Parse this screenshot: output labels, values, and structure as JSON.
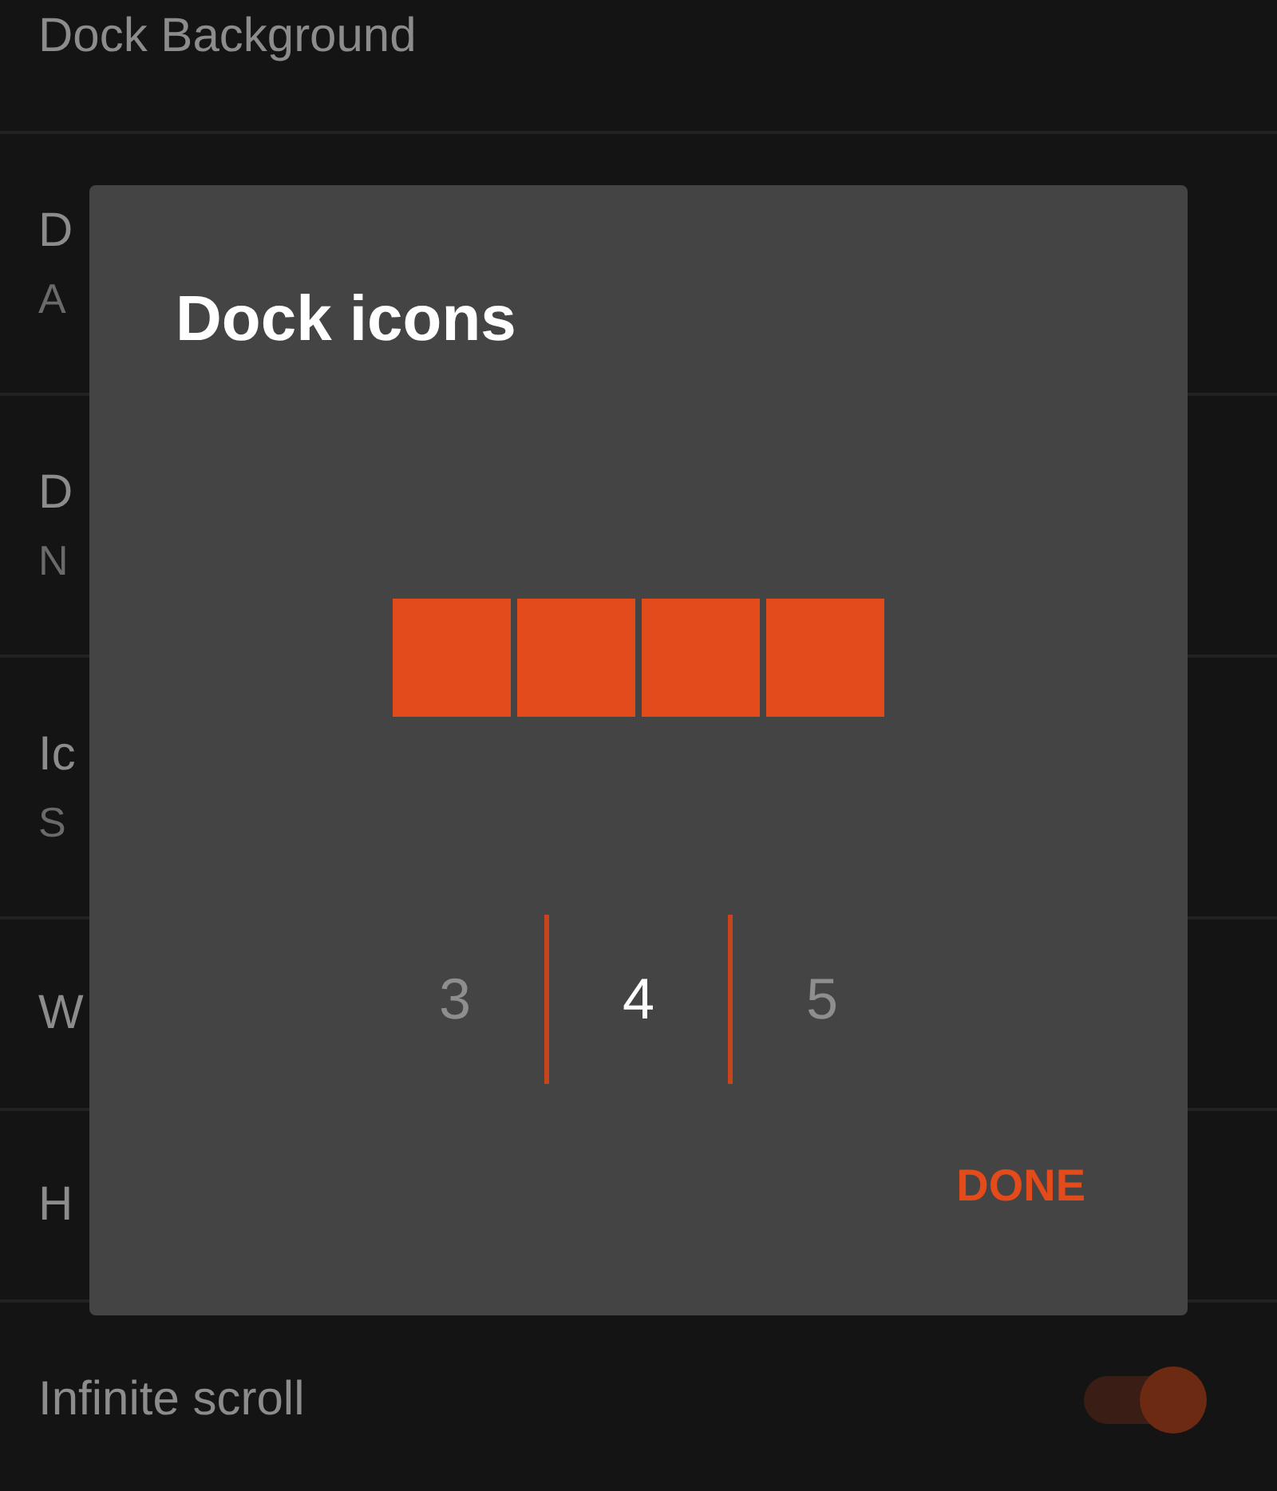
{
  "settings": [
    {
      "kind": "one-line",
      "title": "Dock Background"
    },
    {
      "kind": "two-line",
      "title": "D",
      "subtitle": "A"
    },
    {
      "kind": "two-line",
      "title": "D",
      "subtitle": "N"
    },
    {
      "kind": "two-line",
      "title": "Ic",
      "subtitle": "S"
    },
    {
      "kind": "one-line",
      "title": "W"
    },
    {
      "kind": "one-line",
      "title": "H"
    },
    {
      "kind": "toggle",
      "title": "Infinite scroll",
      "on": true
    }
  ],
  "dialog": {
    "title": "Dock icons",
    "options": [
      {
        "label": "3",
        "selected": false
      },
      {
        "label": "4",
        "selected": true
      },
      {
        "label": "5",
        "selected": false
      }
    ],
    "button": "DONE"
  }
}
